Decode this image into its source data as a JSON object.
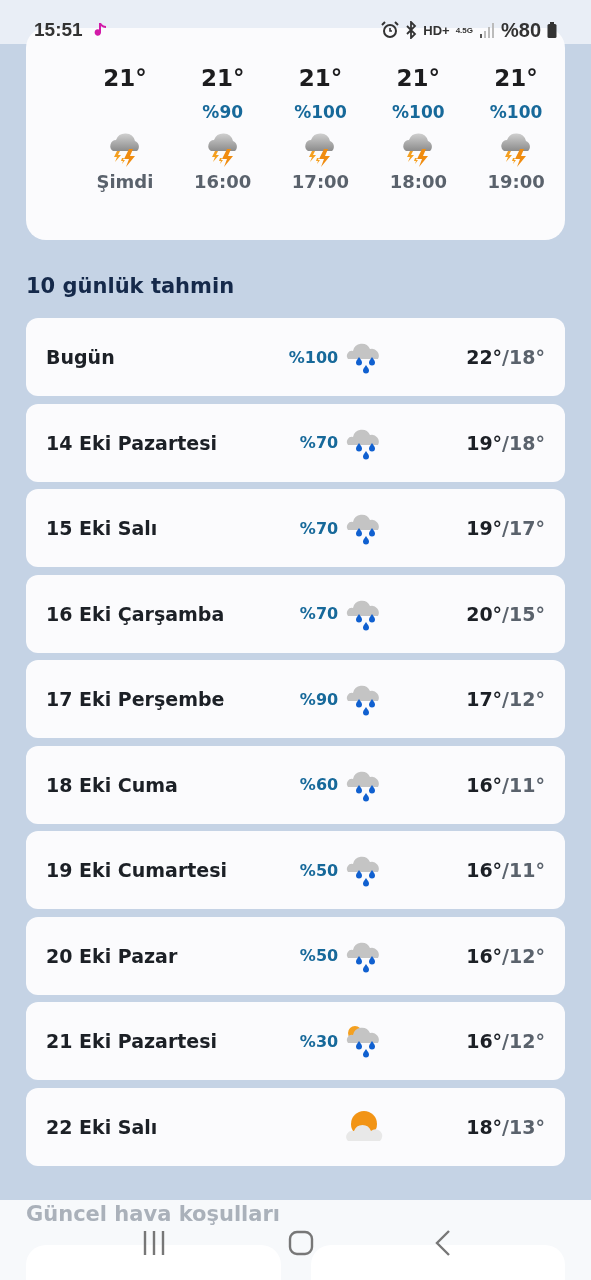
{
  "status_bar": {
    "time": "15:51",
    "network_hd": "HD+",
    "network_type": "4.5G",
    "battery": "%80"
  },
  "hourly": [
    {
      "temp": "21°",
      "time": "Şimdi",
      "kind": "thunder"
    },
    {
      "temp": "21°",
      "precip": "%90",
      "time": "16:00",
      "kind": "thunder"
    },
    {
      "temp": "21°",
      "precip": "%100",
      "time": "17:00",
      "kind": "thunder"
    },
    {
      "temp": "21°",
      "precip": "%100",
      "time": "18:00",
      "kind": "thunder"
    },
    {
      "temp": "21°",
      "precip": "%100",
      "time": "19:00",
      "kind": "thunder"
    }
  ],
  "forecast_title": "10 günlük tahmin",
  "days": [
    {
      "day": "Bugün",
      "precip": "%100",
      "kind": "rain",
      "high": "22°",
      "low": "/18°"
    },
    {
      "day": "14 Eki Pazartesi",
      "precip": "%70",
      "kind": "rain",
      "high": "19°",
      "low": "/18°"
    },
    {
      "day": "15 Eki Salı",
      "precip": "%70",
      "kind": "rain",
      "high": "19°",
      "low": "/17°"
    },
    {
      "day": "16 Eki Çarşamba",
      "precip": "%70",
      "kind": "rain",
      "high": "20°",
      "low": "/15°"
    },
    {
      "day": "17 Eki Perşembe",
      "precip": "%90",
      "kind": "rain",
      "high": "17°",
      "low": "/12°"
    },
    {
      "day": "18 Eki Cuma",
      "precip": "%60",
      "kind": "rain",
      "high": "16°",
      "low": "/11°"
    },
    {
      "day": "19 Eki Cumartesi",
      "precip": "%50",
      "kind": "rain",
      "high": "16°",
      "low": "/11°"
    },
    {
      "day": "20 Eki Pazar",
      "precip": "%50",
      "kind": "rain",
      "high": "16°",
      "low": "/12°"
    },
    {
      "day": "21 Eki Pazartesi",
      "precip": "%30",
      "kind": "sun-rain",
      "high": "16°",
      "low": "/12°"
    },
    {
      "day": "22 Eki Salı",
      "kind": "partly-cloudy",
      "high": "18°",
      "low": "/13°"
    }
  ],
  "next_section_title": "Güncel hava koşulları"
}
